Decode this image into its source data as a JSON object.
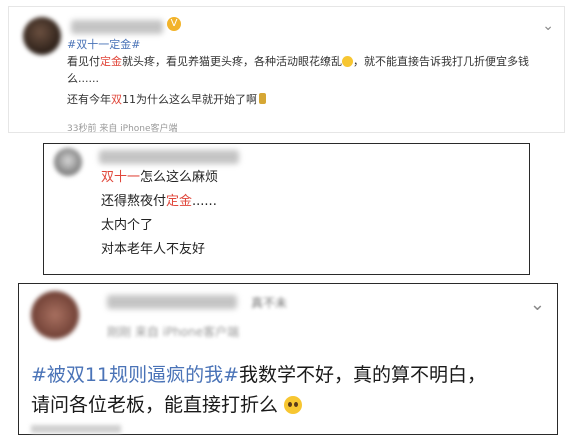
{
  "post1": {
    "hashtag": "#双十一定金#",
    "line1_a": "看见付",
    "line1_hl": "定金",
    "line1_b": "就头疼，看见养猫更头疼，各种活动眼花缭乱",
    "line1_c": "，就不能直接告诉我打几折便宜多钱",
    "line2": "么......",
    "line3_a": "还有今年",
    "line3_hl": "双",
    "line3_b": "11为什么这么早就开始了啊",
    "meta": "33秒前 来自 iPhone客户端"
  },
  "post2": {
    "line1_hl": "双十一",
    "line1_b": "怎么这么麻烦",
    "line2_a": "还得熬夜付",
    "line2_hl": "定金",
    "line2_b": "......",
    "line3": "太内个了",
    "line4": "对本老年人不友好"
  },
  "post3": {
    "name_tail": "真不未",
    "meta": "刚刚 来自 iPhone客户端",
    "line1_tag": "#被双11规则逼疯的我#",
    "line1_b": "我数学不好，真的算不明白，",
    "line2": "请问各位老板，能直接打折么"
  },
  "icons": {
    "expand": "chevron-down-icon",
    "verified": "verified-icon"
  }
}
